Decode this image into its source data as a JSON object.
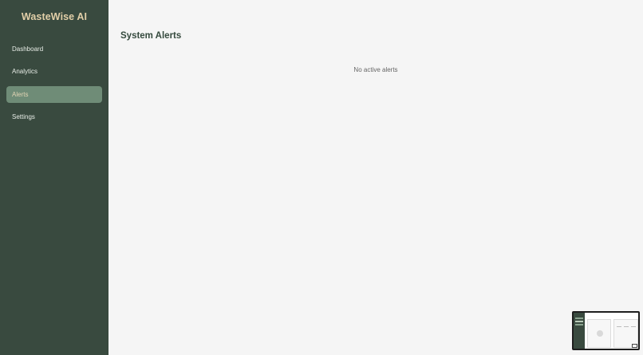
{
  "sidebar": {
    "brand": "WasteWise AI",
    "items": [
      {
        "label": "Dashboard",
        "active": false
      },
      {
        "label": "Analytics",
        "active": false
      },
      {
        "label": "Alerts",
        "active": true
      },
      {
        "label": "Settings",
        "active": false
      }
    ]
  },
  "main": {
    "title": "System Alerts",
    "empty_message": "No active alerts"
  },
  "colors": {
    "sidebar_bg": "#394a3f",
    "active_item_bg": "#6f8c77",
    "brand": "#e2cfa8",
    "title": "#34493d",
    "page_bg": "#f5f5f5"
  },
  "preview": {
    "icon": "window-preview-thumbnail"
  }
}
